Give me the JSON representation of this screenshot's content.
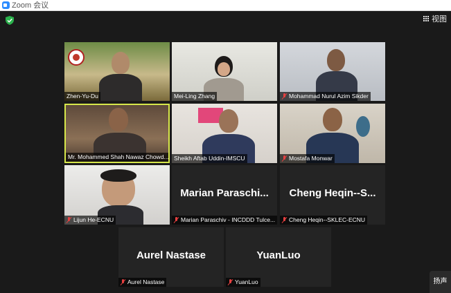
{
  "window": {
    "title": "Zoom 会议",
    "icon": "zoom-app-icon"
  },
  "toolbar": {
    "security_icon": "shield-check-icon",
    "view_label": "视图",
    "view_icon": "grid-icon"
  },
  "participants": [
    {
      "name": "Zhen-Yu-Du",
      "video": true,
      "muted": false,
      "active": false
    },
    {
      "name": "Mei-Ling Zhang",
      "video": true,
      "muted": false,
      "active": false
    },
    {
      "name": "Mohammad Nurul Azim Sikder",
      "video": true,
      "muted": true,
      "active": false
    },
    {
      "name": "Mr. Mohammed Shah Nawaz Chowd...",
      "video": true,
      "muted": false,
      "active": true
    },
    {
      "name": "Sheikh Aftab Uddin-IMSCU",
      "video": true,
      "muted": false,
      "active": false
    },
    {
      "name": "Mostafa Monwar",
      "video": true,
      "muted": true,
      "active": false
    },
    {
      "name": "Lijun He-ECNU",
      "video": true,
      "muted": true,
      "active": false
    },
    {
      "name": "Marian Paraschiv - INCDDD Tulce...",
      "display_name": "Marian Paraschi...",
      "video": false,
      "muted": true,
      "active": false
    },
    {
      "name": "Cheng Heqin--SKLEC-ECNU",
      "display_name": "Cheng Heqin--S...",
      "video": false,
      "muted": true,
      "active": false
    },
    {
      "name": "Aurel Nastase",
      "display_name": "Aurel Nastase",
      "video": false,
      "muted": true,
      "active": false
    },
    {
      "name": "YuanLuo",
      "display_name": "YuanLuo",
      "video": false,
      "muted": true,
      "active": false
    }
  ],
  "corner_button": {
    "label": "扬声"
  },
  "colors": {
    "background": "#1a1a1a",
    "active_speaker_border": "#d7e84a",
    "muted_icon": "#e54040",
    "security_green": "#2bb24c"
  }
}
